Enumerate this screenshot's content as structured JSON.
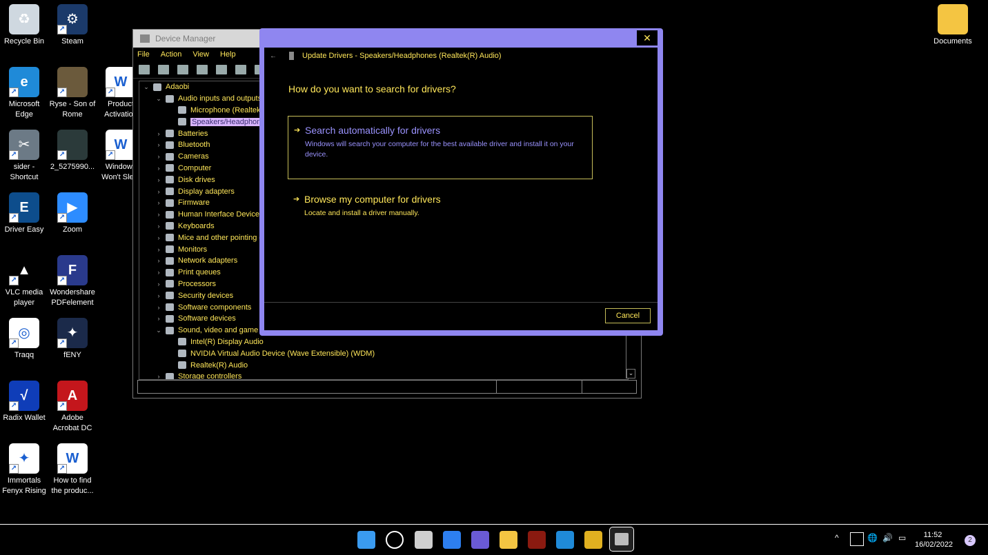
{
  "desktop_icons": [
    {
      "label": "Recycle Bin",
      "icon": "recycle-bin-icon",
      "color": "#cfd8e0",
      "glyph": "♻"
    },
    {
      "label": "Steam",
      "icon": "steam-icon",
      "color": "#1b3a6a",
      "glyph": "⚙"
    },
    {
      "label": "Microsoft Edge",
      "icon": "edge-icon",
      "color": "#1f8ad8",
      "glyph": "e"
    },
    {
      "label": "Ryse - Son of Rome",
      "icon": "ryse-icon",
      "color": "#6b5a3c",
      "glyph": ""
    },
    {
      "label": "Product Activation",
      "icon": "word-doc-icon",
      "color": "#ffffff",
      "glyph": "W"
    },
    {
      "label": "sider - Shortcut",
      "icon": "tools-icon",
      "color": "#6c7a86",
      "glyph": "✂"
    },
    {
      "label": "2_5275990...",
      "icon": "image-file-icon",
      "color": "#2b3a3a",
      "glyph": ""
    },
    {
      "label": "Windows Won't Sle...",
      "icon": "word-doc-icon",
      "color": "#ffffff",
      "glyph": "W"
    },
    {
      "label": "Driver Easy",
      "icon": "driver-easy-icon",
      "color": "#0d4d8c",
      "glyph": "E"
    },
    {
      "label": "Zoom",
      "icon": "zoom-icon",
      "color": "#2d8cff",
      "glyph": "▶"
    },
    {
      "label": "VLC media player",
      "icon": "vlc-icon",
      "color": "#000000",
      "glyph": "▲"
    },
    {
      "label": "Wondershare PDFelement",
      "icon": "pdfelement-icon",
      "color": "#2a3a8c",
      "glyph": "F"
    },
    {
      "label": "Traqq",
      "icon": "traqq-icon",
      "color": "#ffffff",
      "glyph": "◎"
    },
    {
      "label": "fENY",
      "icon": "feny-icon",
      "color": "#1b2a4a",
      "glyph": "✦"
    },
    {
      "label": "Radix Wallet",
      "icon": "radix-icon",
      "color": "#0f3db8",
      "glyph": "√"
    },
    {
      "label": "Adobe Acrobat DC",
      "icon": "acrobat-icon",
      "color": "#c4161c",
      "glyph": "A"
    },
    {
      "label": "Immortals Fenyx Rising",
      "icon": "immortals-icon",
      "color": "#ffffff",
      "glyph": "✦"
    },
    {
      "label": "How to find the produc...",
      "icon": "word-doc-icon",
      "color": "#ffffff",
      "glyph": "W"
    },
    {
      "label": "Documents",
      "icon": "folder-icon",
      "color": "#f4c542",
      "glyph": ""
    }
  ],
  "devmgr": {
    "title": "Device Manager",
    "menu": [
      "File",
      "Action",
      "View",
      "Help"
    ],
    "tree": [
      {
        "text": "Adaobi",
        "level": 0,
        "chev": "⌄"
      },
      {
        "text": "Audio inputs and outputs",
        "level": 1,
        "chev": "⌄"
      },
      {
        "text": "Microphone (Realtek(R) Audio)",
        "level": 2,
        "chev": ""
      },
      {
        "text": "Speakers/Headphones (Realtek(R) Audio)",
        "level": 2,
        "chev": "",
        "selected": true
      },
      {
        "text": "Batteries",
        "level": 1,
        "chev": "›"
      },
      {
        "text": "Bluetooth",
        "level": 1,
        "chev": "›"
      },
      {
        "text": "Cameras",
        "level": 1,
        "chev": "›"
      },
      {
        "text": "Computer",
        "level": 1,
        "chev": "›"
      },
      {
        "text": "Disk drives",
        "level": 1,
        "chev": "›"
      },
      {
        "text": "Display adapters",
        "level": 1,
        "chev": "›"
      },
      {
        "text": "Firmware",
        "level": 1,
        "chev": "›"
      },
      {
        "text": "Human Interface Devices",
        "level": 1,
        "chev": "›"
      },
      {
        "text": "Keyboards",
        "level": 1,
        "chev": "›"
      },
      {
        "text": "Mice and other pointing devices",
        "level": 1,
        "chev": "›"
      },
      {
        "text": "Monitors",
        "level": 1,
        "chev": "›"
      },
      {
        "text": "Network adapters",
        "level": 1,
        "chev": "›"
      },
      {
        "text": "Print queues",
        "level": 1,
        "chev": "›"
      },
      {
        "text": "Processors",
        "level": 1,
        "chev": "›"
      },
      {
        "text": "Security devices",
        "level": 1,
        "chev": "›"
      },
      {
        "text": "Software components",
        "level": 1,
        "chev": "›"
      },
      {
        "text": "Software devices",
        "level": 1,
        "chev": "›"
      },
      {
        "text": "Sound, video and game controllers",
        "level": 1,
        "chev": "⌄"
      },
      {
        "text": "Intel(R) Display Audio",
        "level": 2,
        "chev": ""
      },
      {
        "text": "NVIDIA Virtual Audio Device (Wave Extensible) (WDM)",
        "level": 2,
        "chev": ""
      },
      {
        "text": "Realtek(R) Audio",
        "level": 2,
        "chev": ""
      },
      {
        "text": "Storage controllers",
        "level": 1,
        "chev": "›"
      }
    ]
  },
  "dialog": {
    "close": "✕",
    "header": "Update Drivers - Speakers/Headphones (Realtek(R) Audio)",
    "question": "How do you want to search for drivers?",
    "option1_title": "Search automatically for drivers",
    "option1_desc": "Windows will search your computer for the best available driver and install it on your device.",
    "option2_title": "Browse my computer for drivers",
    "option2_desc": "Locate and install a driver manually.",
    "cancel": "Cancel",
    "option1_color": "#9b93ff",
    "option2_color": "#ffe75a"
  },
  "taskbar": {
    "apps": [
      {
        "name": "start-button",
        "color": "#3a9bf0"
      },
      {
        "name": "search-button",
        "color": "#000000"
      },
      {
        "name": "task-view-button",
        "color": "#cfcfcf"
      },
      {
        "name": "widgets-button",
        "color": "#2d7ff0"
      },
      {
        "name": "teams-chat-button",
        "color": "#6a5ad6"
      },
      {
        "name": "file-explorer-button",
        "color": "#f4c542"
      },
      {
        "name": "app-button-1",
        "color": "#8a1a10"
      },
      {
        "name": "edge-taskbar-button",
        "color": "#1f8ad8"
      },
      {
        "name": "chrome-taskbar-button",
        "color": "#e0b020"
      },
      {
        "name": "device-manager-taskbar-button",
        "color": "#bcbcbc"
      }
    ],
    "time": "11:52",
    "date": "16/02/2022",
    "notifications": "2"
  }
}
